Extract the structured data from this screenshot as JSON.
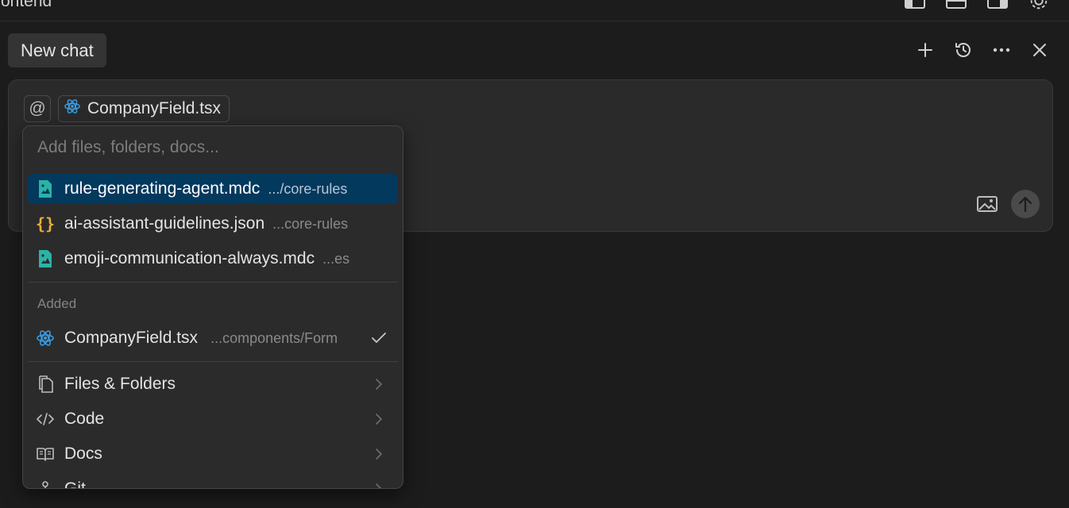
{
  "window": {
    "title": "rontend"
  },
  "chat": {
    "tab_label": "New chat"
  },
  "composer": {
    "at_symbol": "@",
    "context_pill": {
      "label": "CompanyField.tsx",
      "icon": "react-icon"
    }
  },
  "mention_menu": {
    "search_placeholder": "Add files, folders, docs...",
    "suggestions": [
      {
        "name": "rule-generating-agent.mdc",
        "path": ".../core-rules",
        "icon": "mdc-file-icon",
        "selected": true
      },
      {
        "name": "ai-assistant-guidelines.json",
        "path": "...core-rules",
        "icon": "json-braces-icon"
      },
      {
        "name": "emoji-communication-always.mdc",
        "path": "...es",
        "icon": "mdc-file-icon"
      }
    ],
    "added_label": "Added",
    "added": [
      {
        "name": "CompanyField.tsx",
        "path": "...components/Form",
        "icon": "react-icon",
        "checked": true
      }
    ],
    "categories": [
      {
        "label": "Files & Folders",
        "icon": "files-icon"
      },
      {
        "label": "Code",
        "icon": "code-icon"
      },
      {
        "label": "Docs",
        "icon": "book-icon"
      },
      {
        "label": "Git",
        "icon": "git-icon"
      }
    ]
  },
  "colors": {
    "background": "#1c1c1c",
    "composer": "#2a2a2a",
    "selection": "#04395e",
    "react": "#3b9be0",
    "mdc": "#2bb3a6",
    "json": "#e8ad3a"
  }
}
